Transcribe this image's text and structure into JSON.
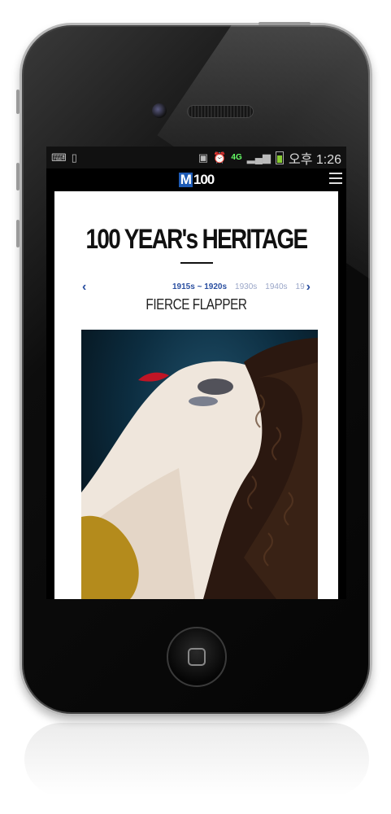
{
  "statusbar": {
    "network": "4G",
    "time_label": "오후 1:26"
  },
  "header": {
    "logo_mark": "M",
    "logo_text": "100"
  },
  "page": {
    "title": "100 YEAR's HERITAGE",
    "eras": [
      "1915s ~ 1920s",
      "1930s",
      "1940s",
      "19"
    ],
    "active_era": "1915s ~ 1920s",
    "subtitle": "FIERCE FLAPPER"
  },
  "icons": {
    "menu": "hamburger-icon",
    "prev": "chevron-left-icon",
    "next": "chevron-right-icon",
    "home": "home-button-icon"
  },
  "colors": {
    "accent": "#2a4fa0",
    "logo_blue": "#1e5bb5",
    "statusbar_bg": "#111111",
    "battery_green": "#88cc33"
  }
}
